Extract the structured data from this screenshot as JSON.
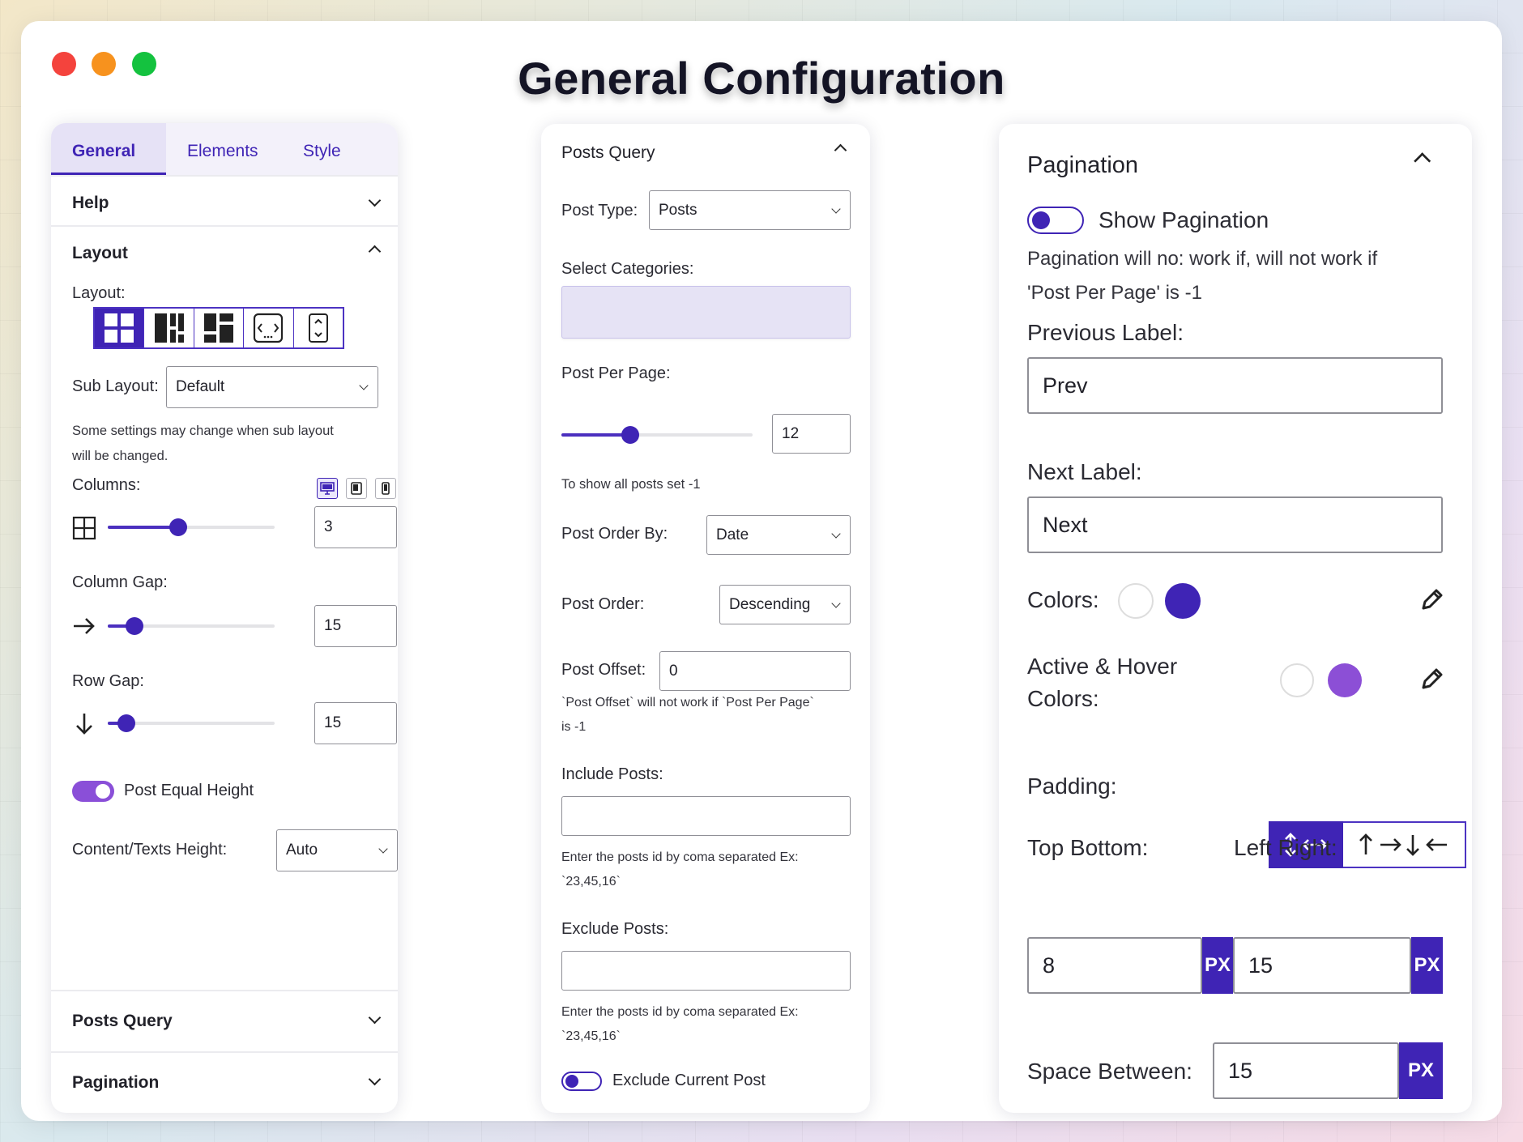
{
  "title": "General Configuration",
  "colors": {
    "accent": "#3f24b5",
    "accent_light": "#8c4fd6",
    "toggle_on": "#8a4fd8",
    "categories_bg": "#e6e3f5"
  },
  "panel_general": {
    "tabs": [
      {
        "label": "General",
        "active": true
      },
      {
        "label": "Elements",
        "active": false
      },
      {
        "label": "Style",
        "active": false
      }
    ],
    "help_label": "Help",
    "layout_section_label": "Layout",
    "layout_label": "Layout:",
    "layout_options": [
      "grid-layout-icon",
      "masonry-layout-icon",
      "mixed-layout-icon",
      "slider-layout-icon",
      "vertical-scroll-layout-icon"
    ],
    "sub_layout_label": "Sub Layout:",
    "sub_layout_value": "Default",
    "sub_layout_note_1": "Some settings may change when sub layout",
    "sub_layout_note_2": "will be changed.",
    "columns_label": "Columns:",
    "columns_value": "3",
    "columns_slider": 0.42,
    "column_gap_label": "Column Gap:",
    "column_gap_value": "15",
    "column_gap_slider": 0.16,
    "row_gap_label": "Row Gap:",
    "row_gap_value": "15",
    "row_gap_slider": 0.11,
    "post_equal_height_label": "Post Equal Height",
    "post_equal_height_on": true,
    "content_height_label": "Content/Texts Height:",
    "content_height_value": "Auto",
    "posts_query_label": "Posts Query",
    "pagination_label": "Pagination"
  },
  "panel_query": {
    "header": "Posts Query",
    "post_type_label": "Post Type:",
    "post_type_value": "Posts",
    "select_categories_label": "Select Categories:",
    "post_per_page_label": "Post Per Page:",
    "post_per_page_value": "12",
    "post_per_page_slider": 0.36,
    "post_per_page_note": "To show all posts set -1",
    "post_order_by_label": "Post Order By:",
    "post_order_by_value": "Date",
    "post_order_label": "Post Order:",
    "post_order_value": "Descending",
    "post_offset_label": "Post Offset:",
    "post_offset_value": "0",
    "post_offset_note_1": "`Post Offset` will not work if `Post Per Page`",
    "post_offset_note_2": "is -1",
    "include_posts_label": "Include Posts:",
    "include_posts_value": "",
    "include_posts_note_1": "Enter the posts id by coma separated Ex:",
    "include_posts_note_2": "`23,45,16`",
    "exclude_posts_label": "Exclude Posts:",
    "exclude_posts_value": "",
    "exclude_posts_note_1": "Enter the posts id by coma separated Ex:",
    "exclude_posts_note_2": "`23,45,16`",
    "exclude_current_post_label": "Exclude Current Post",
    "exclude_current_post_on": false
  },
  "panel_pagination": {
    "header": "Pagination",
    "show_pagination_label": "Show Pagination",
    "show_pagination_on": false,
    "note_1": "Pagination will no: work if, will not work if",
    "note_2": "'Post Per Page' is -1",
    "previous_label_label": "Previous Label:",
    "previous_label_value": "Prev",
    "next_label_label": "Next Label:",
    "next_label_value": "Next",
    "colors_label": "Colors:",
    "colors_text": "#ffffff",
    "colors_bg": "#3f24b5",
    "active_hover_label_1": "Active & Hover",
    "active_hover_label_2": "Colors:",
    "active_hover_text": "#ffffff",
    "active_hover_bg": "#8c4fd6",
    "padding_label": "Padding:",
    "top_bottom_label": "Top Bottom:",
    "top_bottom_value": "8",
    "left_right_label": "Left Right:",
    "left_right_value": "15",
    "unit": "PX",
    "space_between_label": "Space Between:",
    "space_between_value": "15"
  }
}
